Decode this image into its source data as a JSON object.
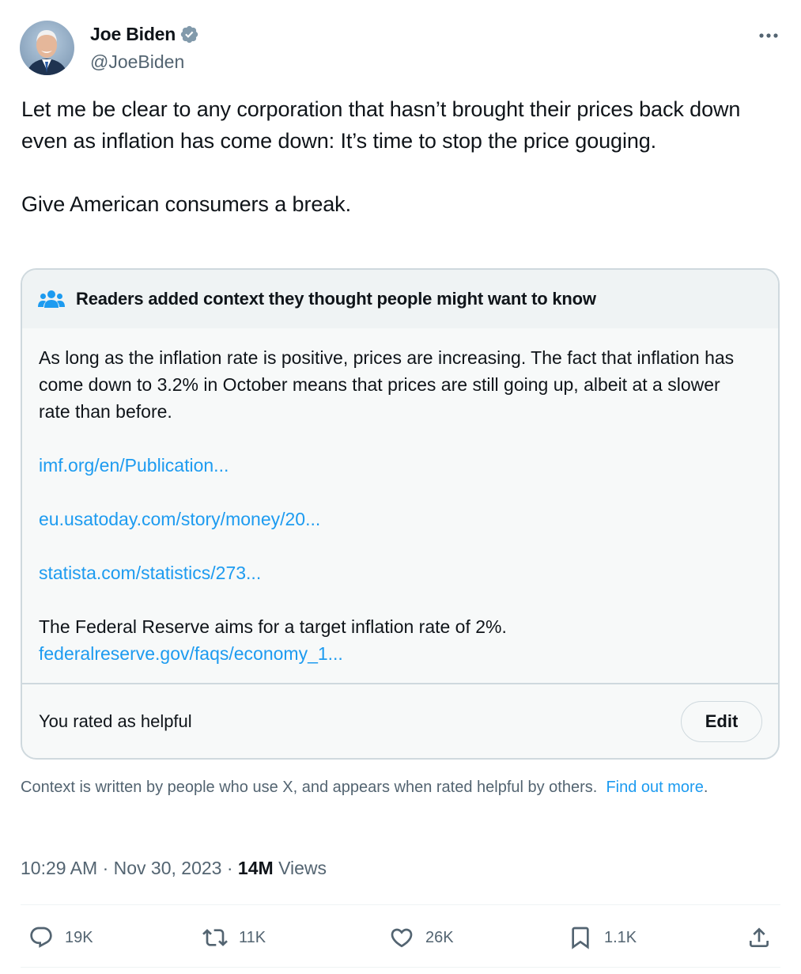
{
  "author": {
    "name": "Joe Biden",
    "handle": "@JoeBiden",
    "verified": true,
    "verified_color": "#829aab"
  },
  "tweet": {
    "text": "Let me be clear to any corporation that hasn’t brought their prices back down even as inflation has come down: It’s time to stop the price gouging.\n\nGive American consumers a break."
  },
  "community_note": {
    "header": "Readers added context they thought people might want to know",
    "body": "As long as the inflation rate is positive, prices are increasing. The fact that inflation has come down to 3.2% in October means that prices are still going up, albeit at a slower rate than before.",
    "links": [
      "imf.org/en/Publication...",
      "eu.usatoday.com/story/money/20...",
      "statista.com/statistics/273..."
    ],
    "extra_text": "The Federal Reserve aims for a target inflation rate of 2%.",
    "extra_link": "federalreserve.gov/faqs/economy_1...",
    "rating_status": "You rated as helpful",
    "edit_label": "Edit"
  },
  "context_footer": {
    "text": "Context is written by people who use X, and appears when rated helpful by others.",
    "link_label": "Find out more",
    "trailing": "."
  },
  "meta": {
    "time": "10:29 AM",
    "date": "Nov 30, 2023",
    "separator": "·",
    "views_count": "14M",
    "views_label": "Views"
  },
  "actions": {
    "replies": "19K",
    "reposts": "11K",
    "likes": "26K",
    "bookmarks": "1.1K"
  },
  "colors": {
    "link": "#1d9bf0",
    "muted": "#536471",
    "border": "#cfd9de"
  }
}
